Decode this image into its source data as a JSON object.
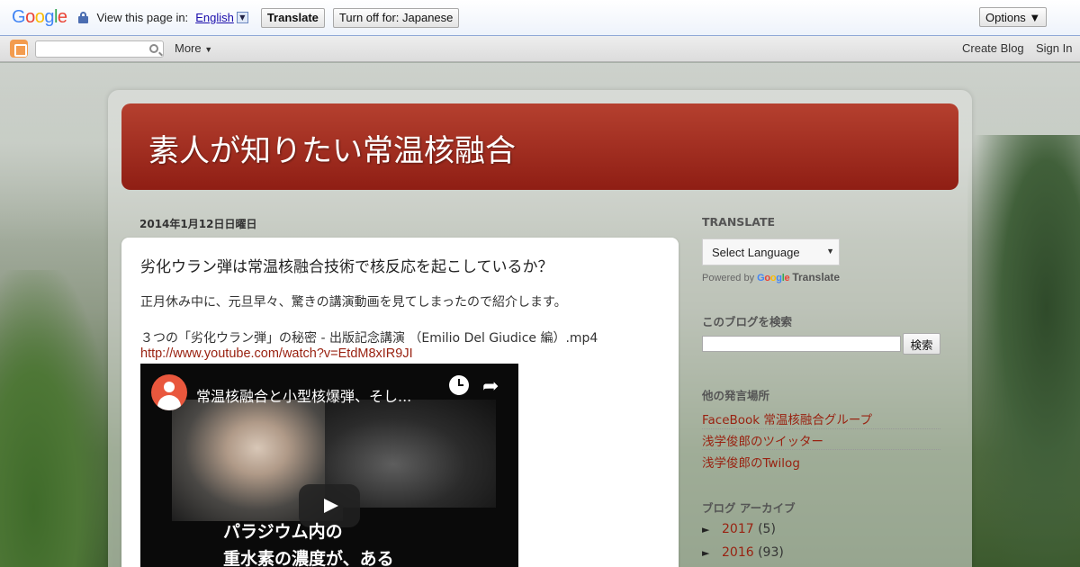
{
  "translate_bar": {
    "logo": "Google",
    "prompt": "View this page in:",
    "language": "English",
    "translate_label": "Translate",
    "turn_off_label": "Turn off for: Japanese",
    "options_label": "Options ▼"
  },
  "navbar": {
    "more_label": "More",
    "create_blog_label": "Create Blog",
    "sign_in_label": "Sign In"
  },
  "blog": {
    "title": "素人が知りたい常温核融合"
  },
  "post": {
    "date": "2014年1月12日日曜日",
    "title": "劣化ウラン弾は常温核融合技術で核反応を起こしているか？",
    "paragraph1": "正月休み中に、元旦早々、驚きの講演動画を見てしまったので紹介します。",
    "paragraph2": "３つの「劣化ウラン弾」の秘密 - 出版記念講演 （Emilio Del Giudice 編）.mp4",
    "link": "http://www.youtube.com/watch?v=EtdM8xIR9JI",
    "video": {
      "title": "常温核融合と小型核爆弾、そし...",
      "subtitle_line1": "パラジウム内の",
      "subtitle_line2": "重水素の濃度が、ある"
    }
  },
  "sidebar": {
    "translate": {
      "heading": "TRANSLATE",
      "select_label": "Select Language",
      "powered_by": "Powered by",
      "google_word": "Google",
      "translate_word": "Translate"
    },
    "search": {
      "heading": "このブログを検索",
      "button": "検索"
    },
    "other_places": {
      "heading": "他の発言場所",
      "links": [
        "FaceBook 常温核融合グループ",
        "浅学俊郎のツイッター",
        "浅学俊郎のTwilog"
      ]
    },
    "archive": {
      "heading": "ブログ アーカイブ",
      "items": [
        {
          "year": "2017",
          "count": "(5)"
        },
        {
          "year": "2016",
          "count": "(93)"
        }
      ]
    }
  },
  "colors": {
    "header_red": "#a3291c",
    "link_red": "#992211"
  }
}
